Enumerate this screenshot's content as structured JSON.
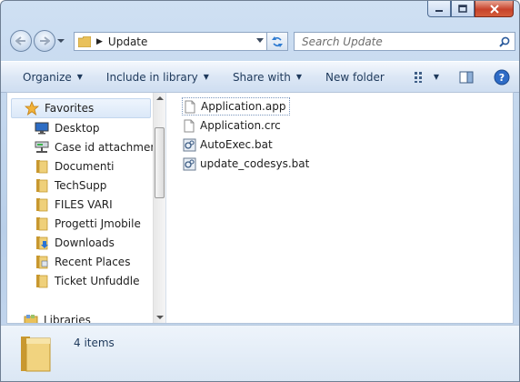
{
  "window": {
    "title": "Update",
    "caption_buttons": {
      "minimize": "minimize-icon",
      "maximize": "maximize-icon",
      "close": "close-icon"
    }
  },
  "address": {
    "path": "Update",
    "search_placeholder": "Search Update"
  },
  "toolbar": {
    "organize": "Organize",
    "include": "Include in library",
    "share": "Share with",
    "new_folder": "New folder"
  },
  "nav": {
    "favorites": "Favorites",
    "items": [
      {
        "label": "Desktop",
        "icon": "desktop-icon"
      },
      {
        "label": "Case id attachment",
        "icon": "network-drive-icon"
      },
      {
        "label": "Documenti",
        "icon": "folder-icon"
      },
      {
        "label": "TechSupp",
        "icon": "folder-icon"
      },
      {
        "label": "FILES VARI",
        "icon": "folder-icon"
      },
      {
        "label": "Progetti Jmobile",
        "icon": "folder-icon"
      },
      {
        "label": "Downloads",
        "icon": "downloads-icon"
      },
      {
        "label": "Recent Places",
        "icon": "recent-places-icon"
      },
      {
        "label": "Ticket Unfuddle",
        "icon": "folder-icon"
      }
    ],
    "libraries": "Libraries"
  },
  "files": [
    {
      "name": "Application.app",
      "icon": "document-icon"
    },
    {
      "name": "Application.crc",
      "icon": "document-icon"
    },
    {
      "name": "AutoExec.bat",
      "icon": "batch-file-icon"
    },
    {
      "name": "update_codesys.bat",
      "icon": "batch-file-icon"
    }
  ],
  "details": {
    "count": "4 items"
  },
  "colors": {
    "accent": "#1e395b",
    "close": "#c7432b",
    "folder": "#e9c15a"
  }
}
